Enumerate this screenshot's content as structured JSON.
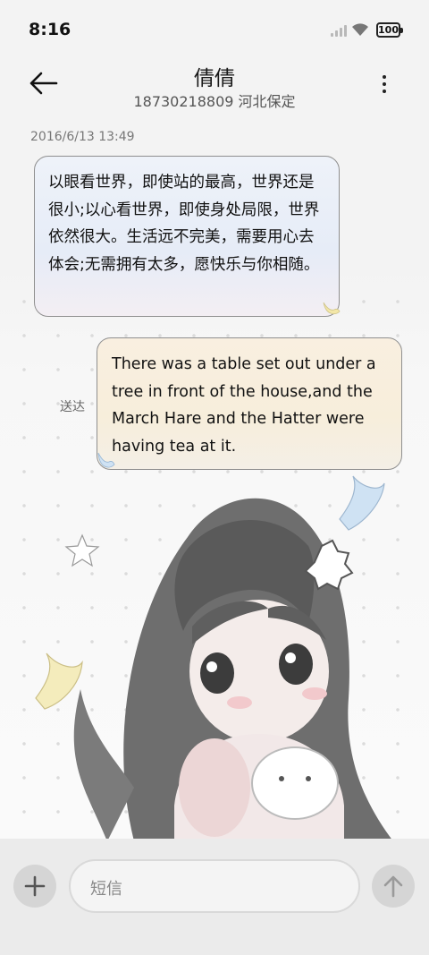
{
  "status_bar": {
    "time": "8:16",
    "battery": "100"
  },
  "header": {
    "contact_name": "倩倩",
    "contact_info": "18730218809 河北保定"
  },
  "conversation": {
    "timestamp": "2016/6/13 13:49",
    "messages": [
      {
        "direction": "incoming",
        "text": "以眼看世界，即使站的最高，世界还是很小;以心看世界，即使身处局限，世界依然很大。生活远不完美，需要用心去体会;无需拥有太多，愿快乐与你相随。"
      },
      {
        "direction": "outgoing",
        "text": "There was a table set out under a tree in front of the house,and the March Hare and the Hatter were having tea at it.",
        "status": "送达"
      }
    ]
  },
  "composer": {
    "placeholder": "短信"
  },
  "icons": {
    "back": "back-arrow-icon",
    "more": "more-vertical-icon",
    "add": "plus-icon",
    "send": "send-arrow-icon"
  }
}
